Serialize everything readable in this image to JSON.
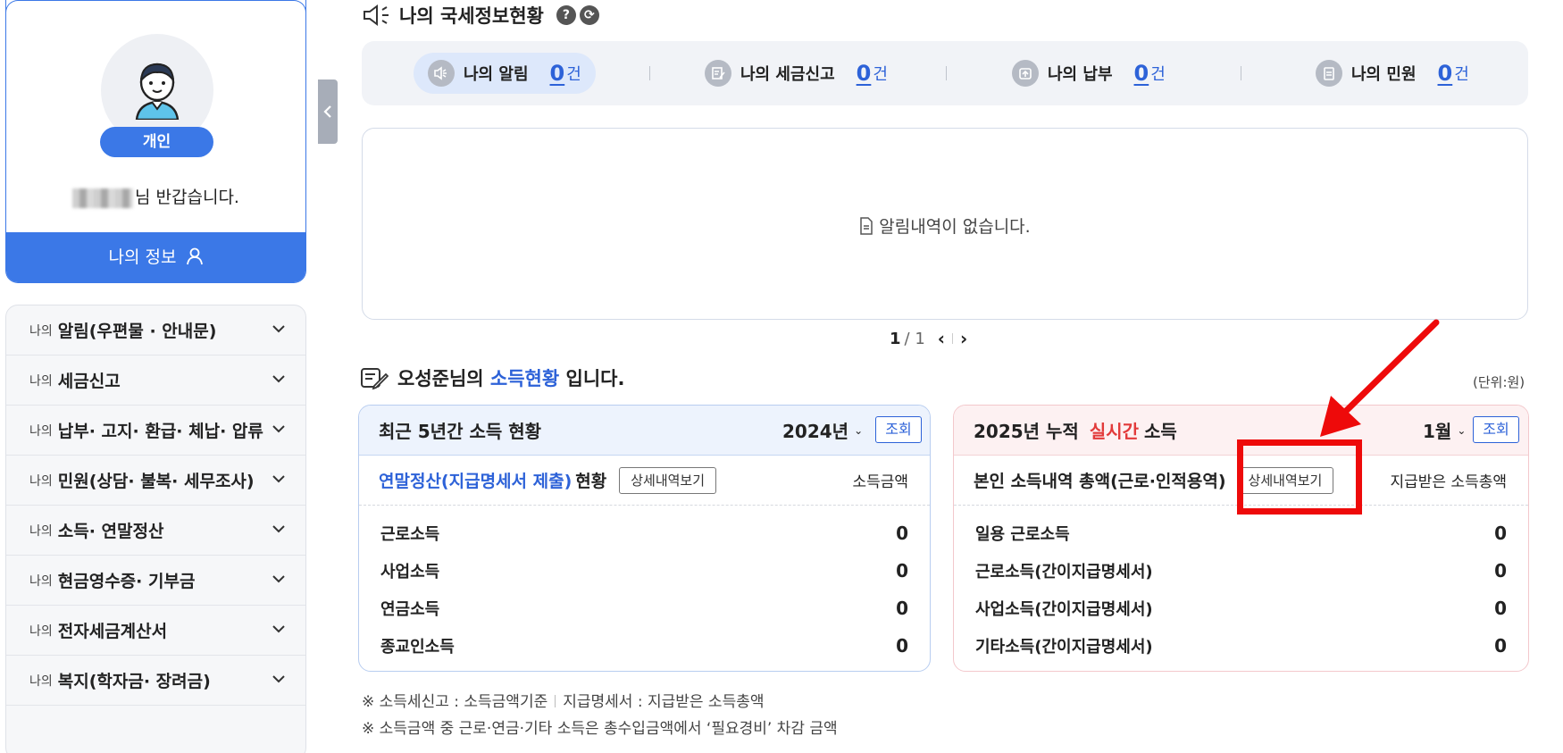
{
  "profile": {
    "user_type": "개인",
    "greeting_suffix": "님 반갑습니다.",
    "my_info_label": "나의 정보"
  },
  "menu": {
    "prefix": "나의",
    "items": [
      {
        "label": "알림(우편물 · 안내문)"
      },
      {
        "label": "세금신고"
      },
      {
        "label": "납부· 고지· 환급· 체납· 압류"
      },
      {
        "label": "민원(상담· 불복· 세무조사)"
      },
      {
        "label": "소득· 연말정산"
      },
      {
        "label": "현금영수증· 기부금"
      },
      {
        "label": "전자세금계산서"
      },
      {
        "label": "복지(학자금· 장려금)"
      }
    ]
  },
  "section": {
    "title": "나의 국세정보현황",
    "help_glyph": "?",
    "refresh_glyph": "⟳"
  },
  "summary": {
    "unit": "건",
    "items": [
      {
        "label": "나의 알림",
        "count": "0",
        "icon": "speaker-icon"
      },
      {
        "label": "나의 세금신고",
        "count": "0",
        "icon": "edit-doc-icon"
      },
      {
        "label": "나의 납부",
        "count": "0",
        "icon": "payment-icon"
      },
      {
        "label": "나의 민원",
        "count": "0",
        "icon": "clipboard-icon"
      }
    ]
  },
  "alerts": {
    "empty_message": "알림내역이 없습니다."
  },
  "pager": {
    "current": "1",
    "total": "/ 1"
  },
  "income": {
    "user_name": "오성준님의",
    "highlight": "소득현황",
    "suffix": "입니다.",
    "unit_label": "(단위:원)"
  },
  "five_year_card": {
    "title": "최근 5년간 소득 현황",
    "year": "2024년",
    "query_label": "조회",
    "sub_highlight": "연말정산(지급명세서 제출)",
    "sub_suffix": "현황",
    "detail_label": "상세내역보기",
    "right_label": "소득금액",
    "rows": [
      {
        "label": "근로소득",
        "value": "0"
      },
      {
        "label": "사업소득",
        "value": "0"
      },
      {
        "label": "연금소득",
        "value": "0"
      },
      {
        "label": "종교인소득",
        "value": "0"
      }
    ]
  },
  "realtime_card": {
    "title_prefix": "2025년 누적",
    "title_red": "실시간",
    "title_suffix": "소득",
    "month": "1월",
    "query_label": "조회",
    "sub_label": "본인 소득내역 총액(근로·인적용역)",
    "detail_label": "상세내역보기",
    "right_label": "지급받은 소득총액",
    "rows": [
      {
        "label": "일용 근로소득",
        "value": "0"
      },
      {
        "label": "근로소득(간이지급명세서)",
        "value": "0"
      },
      {
        "label": "사업소득(간이지급명세서)",
        "value": "0"
      },
      {
        "label": "기타소득(간이지급명세서)",
        "value": "0"
      }
    ]
  },
  "notes": {
    "line1_a": "※ 소득세신고 : 소득금액기준",
    "line1_b": "지급명세서 : 지급받은 소득총액",
    "line2": "※ 소득금액 중 근로·연금·기타 소득은 총수입금액에서 ‘필요경비’ 차감 금액"
  },
  "colors": {
    "accent": "#3b78e7",
    "link": "#2d62d8",
    "highlight_red": "#ee0a0a"
  }
}
